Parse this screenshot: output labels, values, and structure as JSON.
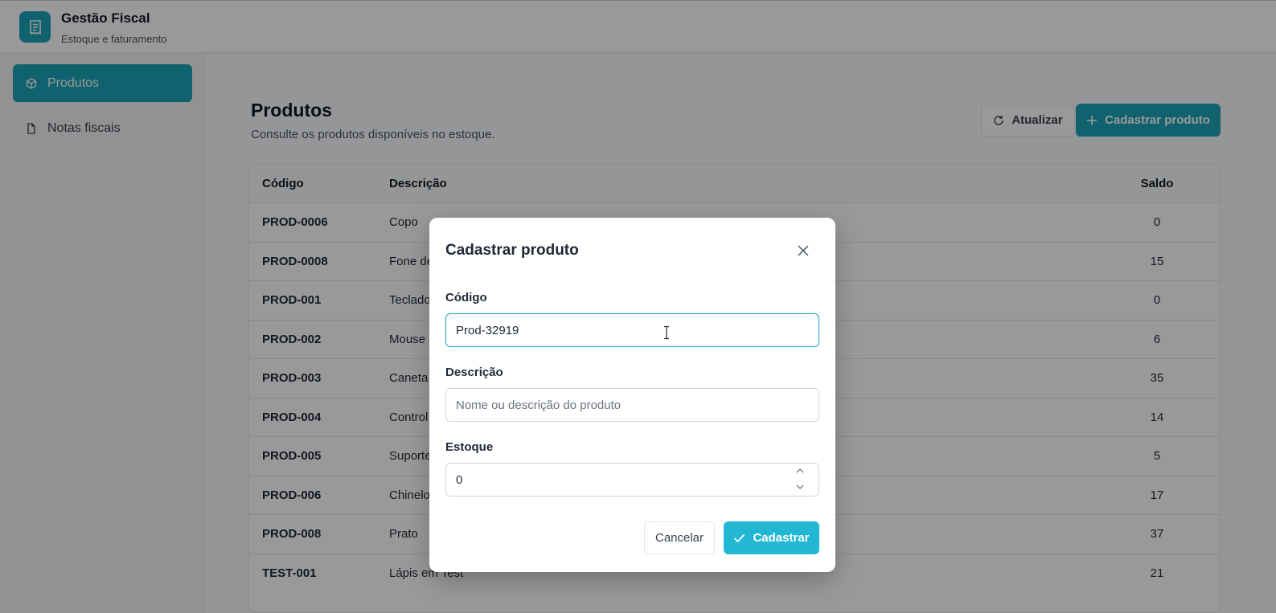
{
  "header": {
    "title": "Gestão Fiscal",
    "subtitle": "Estoque e faturamento"
  },
  "sidebar": {
    "items": [
      {
        "label": "Produtos",
        "icon": "box-icon",
        "active": true
      },
      {
        "label": "Notas fiscais",
        "icon": "file-icon",
        "active": false
      }
    ]
  },
  "page": {
    "title": "Produtos",
    "subtitle": "Consulte os produtos disponíveis no estoque.",
    "refresh_label": "Atualizar",
    "new_label": "Cadastrar produto"
  },
  "table": {
    "columns": [
      "Código",
      "Descrição",
      "Saldo"
    ],
    "rows": [
      {
        "code": "PROD-0006",
        "desc": "Copo",
        "saldo": "0"
      },
      {
        "code": "PROD-0008",
        "desc": "Fone de",
        "saldo": "15"
      },
      {
        "code": "PROD-001",
        "desc": "Teclado",
        "saldo": "0"
      },
      {
        "code": "PROD-002",
        "desc": "Mouse",
        "saldo": "6"
      },
      {
        "code": "PROD-003",
        "desc": "Caneta",
        "saldo": "35"
      },
      {
        "code": "PROD-004",
        "desc": "Control",
        "saldo": "14"
      },
      {
        "code": "PROD-005",
        "desc": "Suporte",
        "saldo": "5"
      },
      {
        "code": "PROD-006",
        "desc": "Chinelo",
        "saldo": "17"
      },
      {
        "code": "PROD-008",
        "desc": "Prato",
        "saldo": "37"
      },
      {
        "code": "TEST-001",
        "desc": "Lápis em Test",
        "saldo": "21"
      }
    ]
  },
  "modal": {
    "title": "Cadastrar produto",
    "codigo_label": "Código",
    "codigo_value": "Prod-32919",
    "descricao_label": "Descrição",
    "descricao_placeholder": "Nome ou descrição do produto",
    "estoque_label": "Estoque",
    "estoque_value": "0",
    "cancel_label": "Cancelar",
    "submit_label": "Cadastrar"
  },
  "colors": {
    "accent": "#1aa3b8",
    "accent_button": "#22b8d3"
  }
}
